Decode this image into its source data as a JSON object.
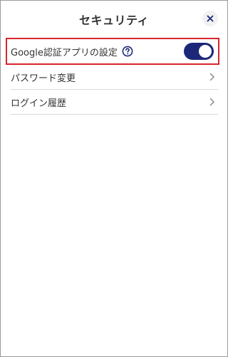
{
  "header": {
    "title": "セキュリティ"
  },
  "settings": {
    "google_auth": {
      "label": "Google認証アプリの設定",
      "enabled": true
    },
    "items": [
      {
        "label": "パスワード変更"
      },
      {
        "label": "ログイン履歴"
      }
    ]
  },
  "colors": {
    "accent": "#1c2778",
    "highlight_border": "#d8262c"
  },
  "icons": {
    "close": "close-icon",
    "help": "help-circle-icon",
    "chevron": "chevron-right-icon"
  }
}
